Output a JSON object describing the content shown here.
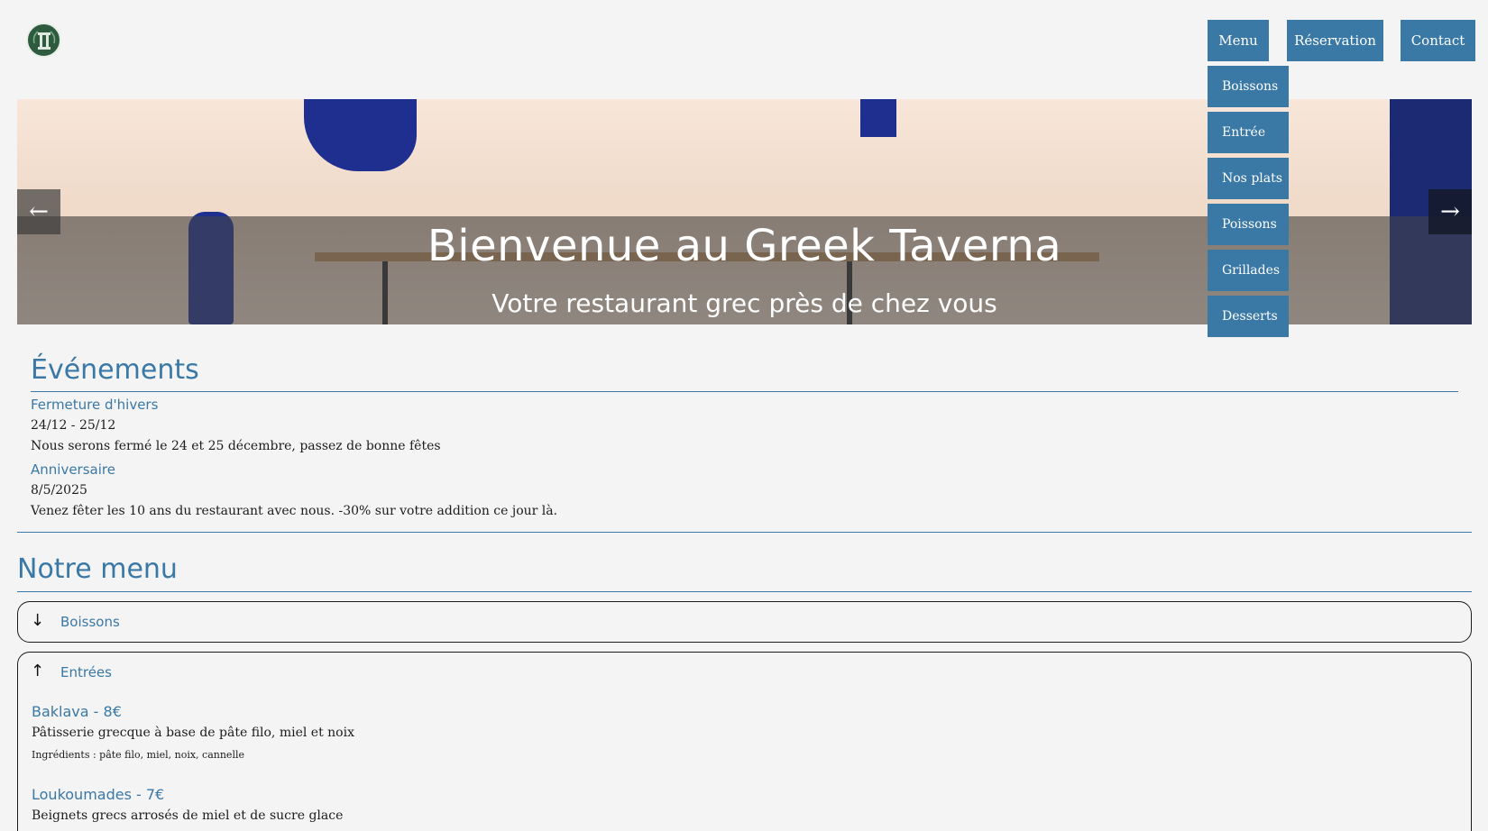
{
  "header": {
    "logo_icon": "greek-column-logo",
    "nav": [
      {
        "label": "Menu"
      },
      {
        "label": "Réservation"
      },
      {
        "label": "Contact"
      }
    ],
    "menu_dropdown": [
      "Boissons",
      "Entrée",
      "Nos plats",
      "Poissons",
      "Grillades",
      "Desserts"
    ]
  },
  "hero": {
    "title": "Bienvenue au Greek Taverna",
    "subtitle": "Votre restaurant grec près de chez vous",
    "prev_icon": "arrow-left-icon",
    "next_icon": "arrow-right-icon"
  },
  "events": {
    "title": "Événements",
    "items": [
      {
        "name": "Fermeture d'hivers",
        "date": "24/12 - 25/12",
        "text": "Nous serons fermé le 24 et 25 décembre, passez de bonne fêtes"
      },
      {
        "name": "Anniversaire",
        "date": "8/5/2025",
        "text": "Venez fêter les 10 ans du restaurant avec nous. -30% sur votre addition ce jour là."
      }
    ]
  },
  "menu": {
    "title": "Notre menu",
    "sections": [
      {
        "label": "Boissons",
        "arrow": "↓",
        "expanded": false
      },
      {
        "label": "Entrées",
        "arrow": "↑",
        "expanded": true
      }
    ],
    "dishes": [
      {
        "name": "Baklava - 8€",
        "desc": "Pâtisserie grecque à base de pâte filo, miel et noix",
        "ingredients": "Ingrédients : pâte filo, miel, noix, cannelle"
      },
      {
        "name": "Loukoumades - 7€",
        "desc": "Beignets grecs arrosés de miel et de sucre glace",
        "ingredients": ""
      }
    ]
  },
  "colors": {
    "accent": "#3a78a6",
    "background": "#f4f4f4",
    "text": "#1c1c1c"
  }
}
